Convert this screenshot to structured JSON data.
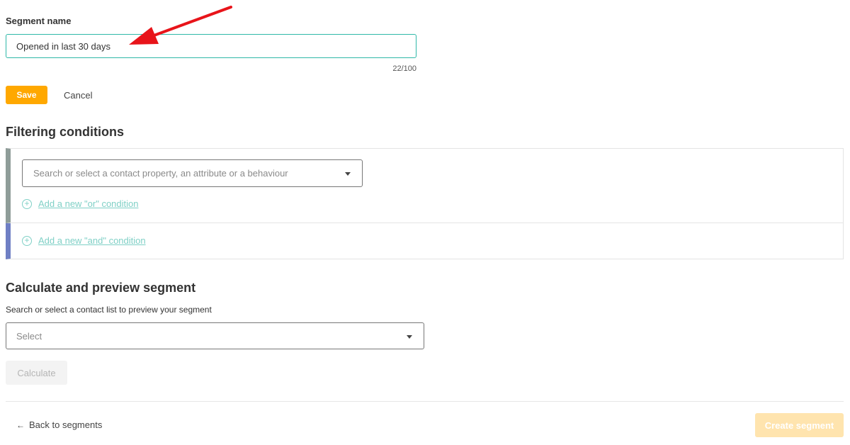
{
  "segment": {
    "label": "Segment name",
    "value": "Opened in last 30 days",
    "char_count": "22/100",
    "save_label": "Save",
    "cancel_label": "Cancel"
  },
  "filtering": {
    "heading": "Filtering conditions",
    "property_placeholder": "Search or select a contact property, an attribute or a behaviour",
    "add_or_label": "Add a new \"or\" condition",
    "add_and_label": "Add a new \"and\" condition"
  },
  "preview": {
    "heading": "Calculate and preview segment",
    "list_label": "Search or select a contact list to preview your segment",
    "select_placeholder": "Select",
    "calculate_label": "Calculate"
  },
  "footer": {
    "back_label": "Back to segments",
    "create_label": "Create segment"
  },
  "colors": {
    "accent": "#ffa800",
    "input_focus": "#2fb8a8",
    "link": "#7fd0c6",
    "or_bar": "#8f9d99",
    "and_bar": "#6f7fc4",
    "annotation_arrow": "#e8141a"
  },
  "icons": [
    "plus-circle-icon",
    "chevron-down-icon",
    "arrow-left-icon",
    "annotation-arrow"
  ]
}
